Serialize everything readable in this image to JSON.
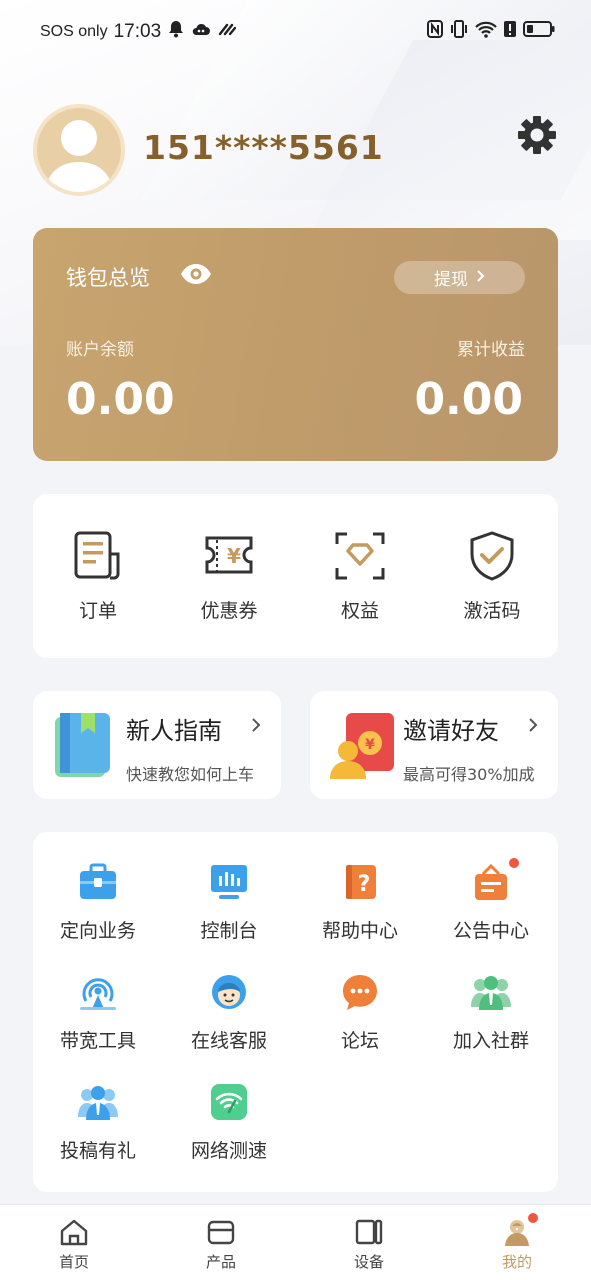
{
  "status_bar": {
    "carrier": "SOS only",
    "time": "17:03"
  },
  "profile": {
    "phone": "151****5561"
  },
  "wallet": {
    "title": "钱包总览",
    "withdraw_label": "提现",
    "balance_label": "账户余额",
    "balance_value": "0.00",
    "earnings_label": "累计收益",
    "earnings_value": "0.00"
  },
  "quick_actions": [
    {
      "label": "订单",
      "icon": "order-icon"
    },
    {
      "label": "优惠券",
      "icon": "coupon-icon"
    },
    {
      "label": "权益",
      "icon": "diamond-icon"
    },
    {
      "label": "激活码",
      "icon": "shield-check-icon"
    }
  ],
  "promos": {
    "guide": {
      "title": "新人指南",
      "subtitle": "快速教您如何上车",
      "icon": "book-icon"
    },
    "invite": {
      "title": "邀请好友",
      "subtitle": "最高可得30%加成",
      "icon": "red-envelope-icon"
    }
  },
  "services": [
    {
      "label": "定向业务",
      "icon": "briefcase-icon"
    },
    {
      "label": "控制台",
      "icon": "monitor-icon"
    },
    {
      "label": "帮助中心",
      "icon": "help-book-icon"
    },
    {
      "label": "公告中心",
      "icon": "notice-board-icon"
    },
    {
      "label": "带宽工具",
      "icon": "broadcast-icon"
    },
    {
      "label": "在线客服",
      "icon": "customer-service-icon"
    },
    {
      "label": "论坛",
      "icon": "chat-bubble-icon"
    },
    {
      "label": "加入社群",
      "icon": "group-icon"
    },
    {
      "label": "投稿有礼",
      "icon": "contributor-icon"
    },
    {
      "label": "网络测速",
      "icon": "wifi-speed-icon"
    }
  ],
  "tabs": [
    {
      "label": "首页",
      "icon": "home-icon"
    },
    {
      "label": "产品",
      "icon": "box-icon"
    },
    {
      "label": "设备",
      "icon": "device-icon"
    },
    {
      "label": "我的",
      "icon": "user-icon",
      "active": true
    }
  ],
  "colors": {
    "accent": "#c29b64",
    "wallet_bg": "#c4a06c",
    "phone_text": "#86602a",
    "badge_red": "#f0553e"
  }
}
